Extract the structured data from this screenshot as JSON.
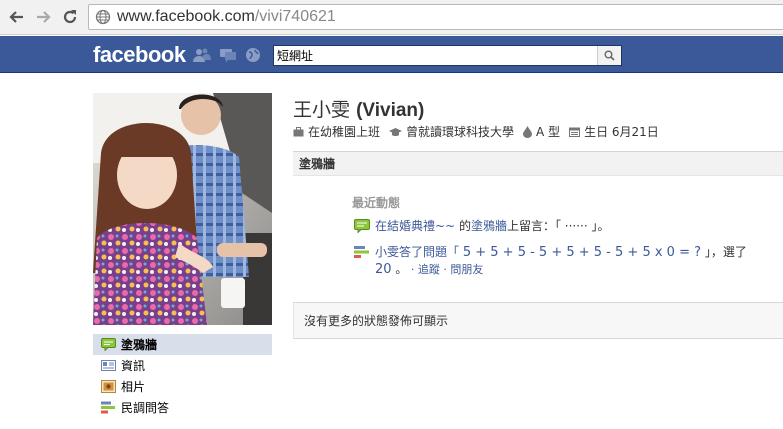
{
  "browser": {
    "url_domain": "www.facebook.com",
    "url_path": "/vivi740621"
  },
  "fb_header": {
    "logo": "facebook",
    "search_value": "短網址"
  },
  "profile": {
    "name_cn": "王小雯",
    "name_en": "(Vivian)",
    "info": {
      "work": "在幼稚園上班",
      "education": "曾就讀環球科技大學",
      "blood_type": "A 型",
      "birthday": "生日 6月21日"
    }
  },
  "left_nav": {
    "items": [
      {
        "label": "塗鴉牆",
        "icon": "wall-icon"
      },
      {
        "label": "資訊",
        "icon": "info-icon"
      },
      {
        "label": "相片",
        "icon": "photos-icon"
      },
      {
        "label": "民調問答",
        "icon": "poll-icon"
      }
    ]
  },
  "wall": {
    "tab_label": "塗鴉牆",
    "recent_title": "最近動態",
    "story1": {
      "link1": "在結婚典禮~~",
      "mid": " 的",
      "link2": "塗鴉牆",
      "rest": "上留言：「 ······ 」。"
    },
    "story2": {
      "lead": "小雯答了問題「",
      "question": "5 + 5 + 5 - 5 + 5 + 5 - 5 + 5 x 0 = ?",
      "mid": "」，選了",
      "answer": "20",
      "tail": " 。",
      "follow": " · 追蹤",
      "ask": " · 問朋友"
    },
    "no_more": "沒有更多的狀態發佈可顯示"
  },
  "colors": {
    "fb_blue": "#3b5998",
    "link": "#3b5998",
    "active_nav": "#d8dfea"
  }
}
